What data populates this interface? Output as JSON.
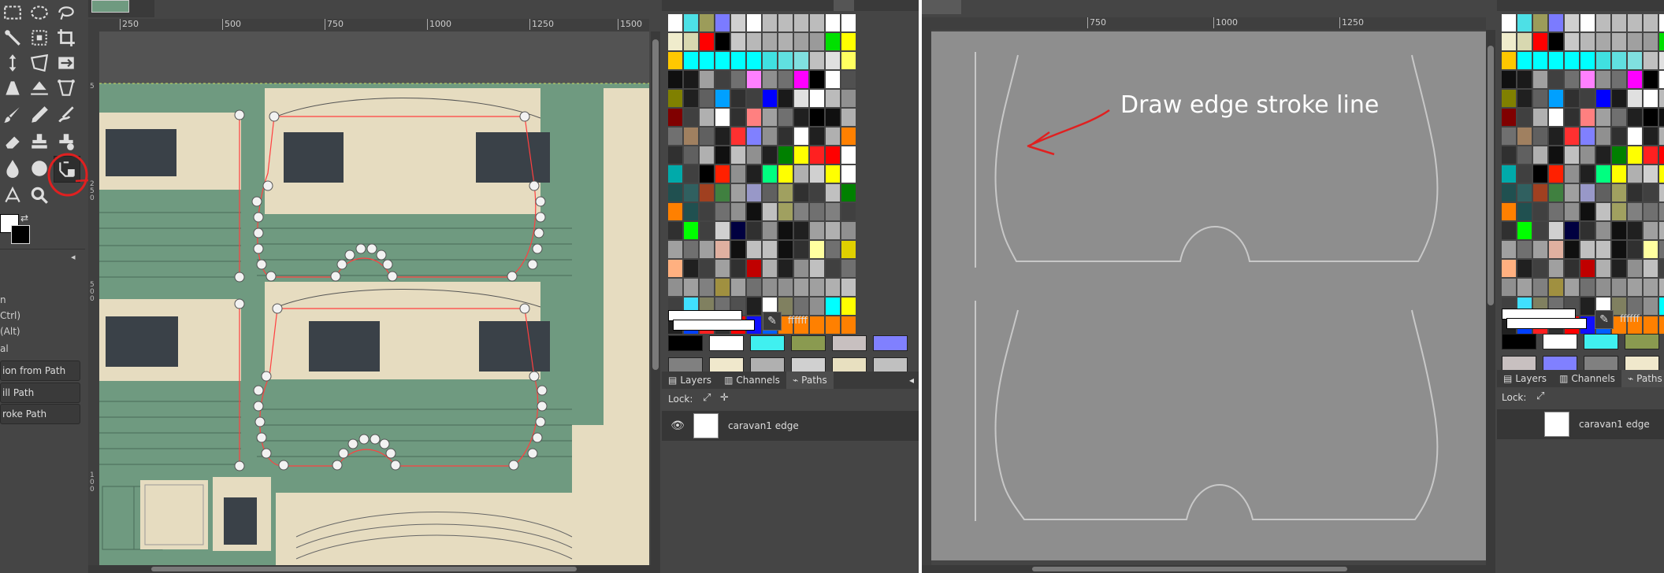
{
  "left": {
    "ruler_ticks": [
      "250",
      "500",
      "750",
      "1000",
      "1250",
      "1500"
    ],
    "vruler_ticks": [
      "5",
      "2 5 0",
      "5 0 0",
      "7 5 0",
      "1 0 0"
    ],
    "tool_options": {
      "line1": "n",
      "line2": "Ctrl)",
      "line3": "(Alt)",
      "line4": "al",
      "btn_selection": "ion from Path",
      "btn_fill": "ill Path",
      "btn_stroke": "roke Path"
    },
    "fg_color_hex": "ffffff",
    "tabs": {
      "layers": "Layers",
      "channels": "Channels",
      "paths": "Paths"
    },
    "lock_label": "Lock:",
    "path_name": "caravan1 edge"
  },
  "right": {
    "ruler_ticks": [
      "750",
      "1000",
      "1250"
    ],
    "annotation": "Draw edge stroke line",
    "fg_color_hex": "ffffff",
    "tabs": {
      "layers": "Layers",
      "channels": "Channels",
      "paths": "Paths"
    },
    "lock_label": "Lock:",
    "path_name": "caravan1 edge"
  },
  "colors": {
    "ui_bg": "#454545",
    "canvas_green": "#6f9a80",
    "paper": "#e6dcc0",
    "annotation_red": "#e02020",
    "gray_canvas": "#8e8e8e"
  },
  "swatches": [
    "#ffffff",
    "#4de0e6",
    "#9c9c5a",
    "#7b7bff",
    "#d0d0d0",
    "#ffffff",
    "#bcbcbc",
    "#bcbcbc",
    "#bcbcbc",
    "#bcbcbc",
    "#ffffff",
    "#ffffff",
    "#f0eccc",
    "#d8d8b0",
    "#ff0000",
    "#000000",
    "#c8c8c8",
    "#b8b8b8",
    "#a8a8a8",
    "#b0b0b0",
    "#a0a0a0",
    "#9a9a9a",
    "#00e000",
    "#ffff00",
    "#ffc800",
    "#00ffff",
    "#00ffff",
    "#00ffff",
    "#00ffff",
    "#00ffff",
    "#40e0e0",
    "#60e0e0",
    "#80e0e0",
    "#c0c0c0",
    "#e0e0e0",
    "#ffff60",
    "#101010",
    "#1a1a1a",
    "#a0a0a0",
    "#404040",
    "#707070",
    "#ff80ff",
    "#909090",
    "#707070",
    "#ff00ff",
    "#000000",
    "#ffffff",
    "#505050",
    "#808000",
    "#202020",
    "#606060",
    "#00a0ff",
    "#303030",
    "#404040",
    "#0000ff",
    "#1a1a1a",
    "#e0e0e0",
    "#ffffff",
    "#bbbbbb",
    "#909090",
    "#800000",
    "#404040",
    "#b0b0b0",
    "#ffffff",
    "#303030",
    "#ff8080",
    "#a0a0a0",
    "#707070",
    "#202020",
    "#000000",
    "#101010",
    "#b0b0b0",
    "#707070",
    "#a08060",
    "#606060",
    "#202020",
    "#ff3030",
    "#8080ff",
    "#909090",
    "#303030",
    "#ffffff",
    "#202020",
    "#b0b0b0",
    "#ff8000",
    "#303030",
    "#606060",
    "#b0b0b0",
    "#101010",
    "#c0c0c0",
    "#909090",
    "#202020",
    "#008000",
    "#ffff00",
    "#ff2020",
    "#ff0000",
    "#ffffff",
    "#00aaaa",
    "#404040",
    "#000000",
    "#ff2000",
    "#909090",
    "#202020",
    "#00ff80",
    "#ffff00",
    "#b0b0b0",
    "#d0d0d0",
    "#ffff00",
    "#ffffff",
    "#205050",
    "#306060",
    "#a04020",
    "#408040",
    "#a0a0a0",
    "#9898c8",
    "#606060",
    "#a0a060",
    "#303030",
    "#404040",
    "#c0c0c0",
    "#008000",
    "#ff8000",
    "#205050",
    "#404040",
    "#707070",
    "#909090",
    "#101010",
    "#c0c0c0",
    "#a0a060",
    "#808080",
    "#707070",
    "#808080",
    "#404040",
    "#303030",
    "#00ff00",
    "#404040",
    "#d0d0d0",
    "#000040",
    "#303030",
    "#909090",
    "#101010",
    "#202020",
    "#a0a0a0",
    "#b0b0b0",
    "#909090",
    "#a0a0a0",
    "#707070",
    "#a0a0a0",
    "#e0b0a0",
    "#101010",
    "#c0c0c0",
    "#c0c0c0",
    "#101010",
    "#303030",
    "#ffffa0",
    "#707070",
    "#e0d000",
    "#ffb080",
    "#202020",
    "#404040",
    "#a0a0a0",
    "#303030",
    "#c00000",
    "#b0b0b0",
    "#202020",
    "#909090",
    "#c0c0c0",
    "#404040",
    "#707070",
    "#909090",
    "#a0a0a0",
    "#808080",
    "#a09040",
    "#a0a0a0",
    "#707070",
    "#909090",
    "#909090",
    "#a0a0a0",
    "#a0a0a0",
    "#b0b0b0",
    "#c0c0c0",
    "#404040",
    "#40e0ff",
    "#808060",
    "#707070",
    "#505050",
    "#202020",
    "#ffffff",
    "#808060",
    "#707070",
    "#909090",
    "#00ffff",
    "#ffff00",
    "#202020",
    "#0040ff",
    "#ff2020",
    "#303030",
    "#ff0000",
    "#1010ff",
    "#0060ff",
    "#ff8000",
    "#ff8000",
    "#ff8000",
    "#ff8000",
    "#ff8000"
  ],
  "quick_colors": [
    "#000000",
    "#ffffff",
    "#40f0f0",
    "#8a9a50",
    "#c8c0c0",
    "#8080ff",
    "#808080",
    "#f0e8cc",
    "#b0b0b0",
    "#d0d0d0",
    "#e8e0c0",
    "#c0c0c0"
  ]
}
